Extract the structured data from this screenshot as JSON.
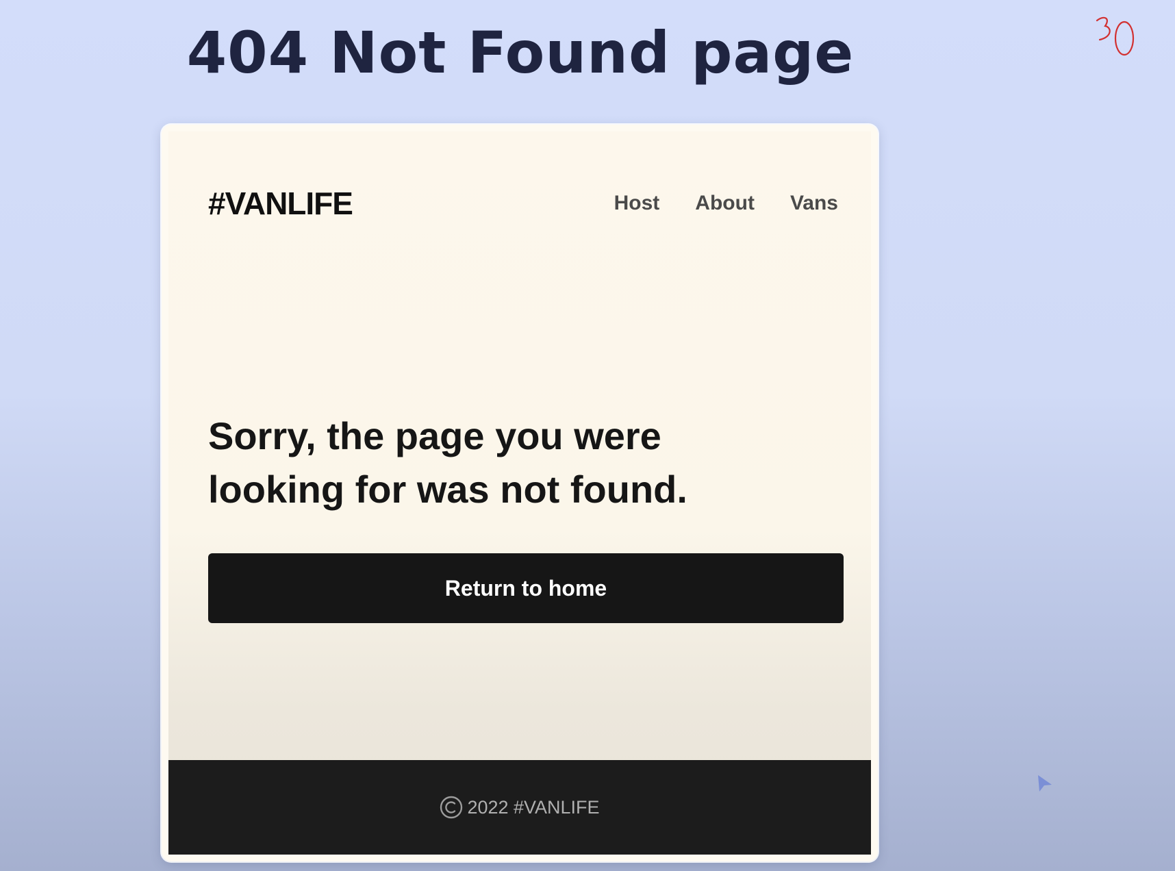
{
  "slide": {
    "title": "404 Not Found page"
  },
  "site": {
    "logo": "#VANLIFE",
    "nav": [
      "Host",
      "About",
      "Vans"
    ],
    "message": "Sorry, the page you were looking for was not found.",
    "button_label": "Return to home",
    "footer_text": "2022 #VANLIFE"
  },
  "icons": {
    "copyright": "copyright-icon",
    "cursor": "cursor-arrow-icon",
    "annotation": "handwritten-annotation"
  },
  "colors": {
    "background": "#d3ddfa",
    "title": "#1f2440",
    "page_background": "#fdf7ec",
    "button": "#161616",
    "footer": "#1c1c1c",
    "annotation": "#d23030"
  }
}
